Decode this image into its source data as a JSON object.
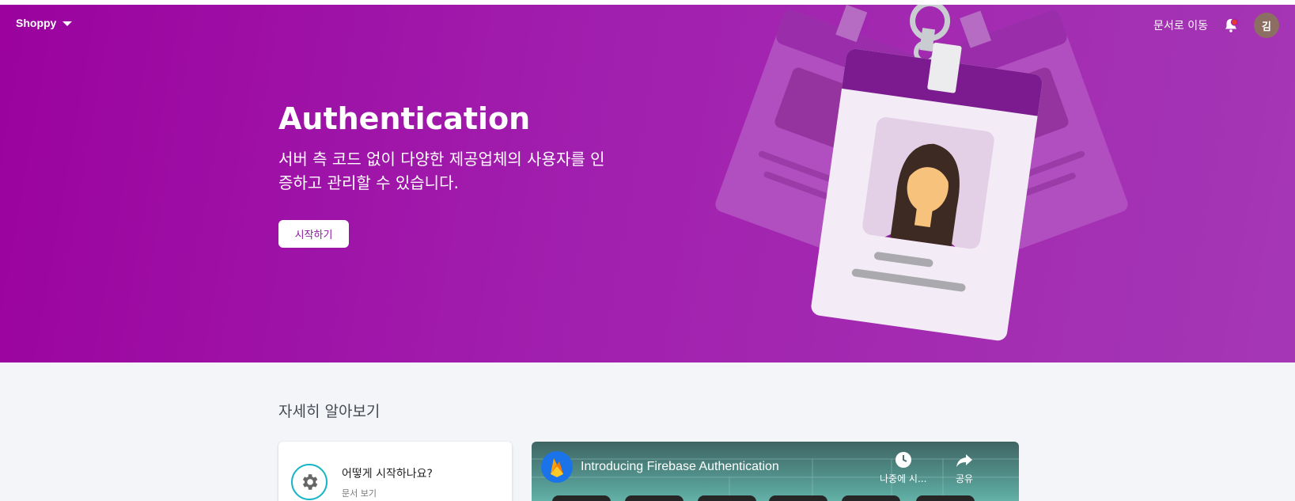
{
  "header": {
    "project_name": "Shoppy",
    "docs_link": "문서로 이동",
    "avatar_initial": "김"
  },
  "hero": {
    "title": "Authentication",
    "description": "서버 측 코드 없이 다양한 제공업체의 사용자를 인증하고 관리할 수 있습니다.",
    "cta_label": "시작하기"
  },
  "learn_more": {
    "section_title": "자세히 알아보기",
    "card": {
      "title": "어떻게 시작하나요?",
      "subtitle": "문서 보기"
    },
    "video": {
      "title": "Introducing Firebase Authentication",
      "watch_later_label": "나중에 시...",
      "share_label": "공유"
    }
  },
  "colors": {
    "hero_start": "#9b029e",
    "hero_end": "#a537b5",
    "accent_cyan": "#17b6c7",
    "button_text": "#8a1a9b"
  },
  "icons": [
    "chevron-down-icon",
    "bell-icon",
    "gear-icon",
    "firebase-logo-icon",
    "clock-icon",
    "share-icon"
  ]
}
